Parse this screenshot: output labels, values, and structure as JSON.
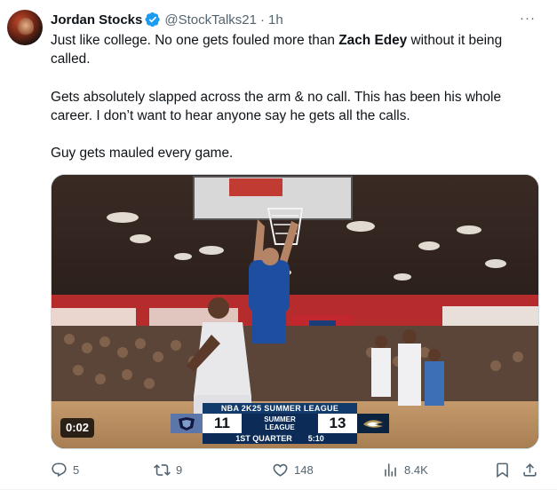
{
  "author": {
    "display_name": "Jordan Stocks",
    "handle": "@StockTalks21",
    "separator": "·",
    "time": "1h",
    "verified_badge": "verified-badge-icon"
  },
  "more_menu": "···",
  "tweet_text": {
    "p1_before": "Just like college. No one gets fouled more than ",
    "p1_bold": "Zach Edey",
    "p1_after": " without it being called.",
    "p2": "Gets absolutely slapped across the arm & no call. This has been his whole career. I don’t want to hear anyone say he gets all the calls.",
    "p3": "Guy gets mauled every game."
  },
  "video": {
    "duration": "0:02",
    "scoreboard": {
      "league": "NBA 2K25 SUMMER LEAGUE",
      "home_score": "11",
      "away_score": "13",
      "center_line1": "SUMMER",
      "center_line2": "LEAGUE",
      "period": "1ST QUARTER",
      "clock": "5:10"
    }
  },
  "actions": {
    "replies": "5",
    "reposts": "9",
    "likes": "148",
    "views": "8.4K"
  },
  "colors": {
    "text": "#0f1419",
    "secondary": "#536471",
    "verified": "#1d9bf0",
    "border": "#cfd9de"
  }
}
